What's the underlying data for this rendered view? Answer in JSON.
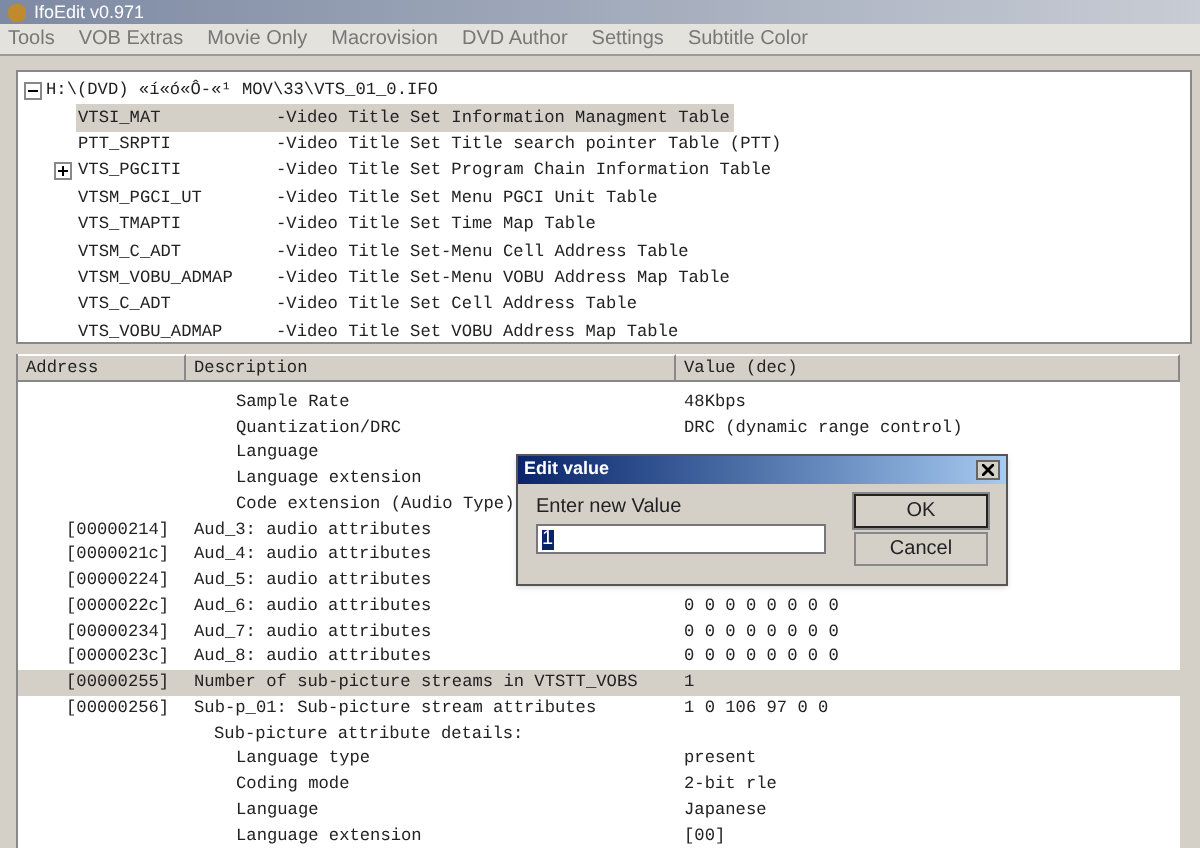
{
  "window": {
    "title": "IfoEdit v0.971"
  },
  "menu": [
    {
      "label": "Tools"
    },
    {
      "label": "VOB Extras"
    },
    {
      "label": "Movie Only"
    },
    {
      "label": "Macrovision"
    },
    {
      "label": "DVD Author"
    },
    {
      "label": "Settings"
    },
    {
      "label": "Subtitle Color"
    }
  ],
  "tree": {
    "label": "H:\\(DVD) «í«ó«Ô-«¹ MOV\\33\\VTS_01_0.IFO",
    "expanded": true,
    "children": [
      {
        "name": "VTSI_MAT",
        "description": "-Video Title Set Information Managment Table",
        "selected": true
      },
      {
        "name": "PTT_SRPTI",
        "description": "-Video Title Set Title search pointer Table (PTT)",
        "selected": false
      },
      {
        "name": "VTS_PGCITI",
        "description": "-Video Title Set Program Chain Information Table",
        "selected": false,
        "expanded": false
      },
      {
        "name": "VTSM_PGCI_UT",
        "description": "-Video Title Set Menu PGCI Unit Table",
        "selected": false
      },
      {
        "name": "VTS_TMAPTI",
        "description": "-Video Title Set Time Map Table",
        "selected": false
      },
      {
        "name": "VTSM_C_ADT",
        "description": "-Video Title Set-Menu Cell Address Table",
        "selected": false
      },
      {
        "name": "VTSM_VOBU_ADMAP",
        "description": "-Video Title Set-Menu VOBU Address Map Table",
        "selected": false
      },
      {
        "name": "VTS_C_ADT",
        "description": "-Video Title Set Cell Address Table",
        "selected": false
      },
      {
        "name": "VTS_VOBU_ADMAP",
        "description": "-Video Title Set VOBU Address Map Table",
        "selected": false
      }
    ]
  },
  "table": {
    "columns": [
      "Address",
      "Description",
      "Value (dec)"
    ],
    "rows": [
      {
        "kind": "detail",
        "description": "Sample Rate",
        "value": "48Kbps",
        "selected": false
      },
      {
        "kind": "detail",
        "description": "Quantization/DRC",
        "value": "DRC (dynamic range control)",
        "selected": false
      },
      {
        "kind": "detail",
        "description": "Language",
        "selected": false
      },
      {
        "kind": "detail",
        "description": "Language extension",
        "selected": false
      },
      {
        "kind": "detail",
        "description": "Code extension (Audio Type)",
        "selected": false
      },
      {
        "kind": "entry",
        "address": "[00000214]",
        "description": "Aud_3: audio attributes",
        "selected": false
      },
      {
        "kind": "entry",
        "address": "[0000021c]",
        "description": "Aud_4: audio attributes",
        "selected": false
      },
      {
        "kind": "entry",
        "address": "[00000224]",
        "description": "Aud_5: audio attributes",
        "selected": false
      },
      {
        "kind": "entry",
        "address": "[0000022c]",
        "description": "Aud_6: audio attributes",
        "value": "0 0 0 0 0 0 0 0",
        "selected": false
      },
      {
        "kind": "entry",
        "address": "[00000234]",
        "description": "Aud_7: audio attributes",
        "value": "0 0 0 0 0 0 0 0",
        "selected": false
      },
      {
        "kind": "entry",
        "address": "[0000023c]",
        "description": "Aud_8: audio attributes",
        "value": "0 0 0 0 0 0 0 0",
        "selected": false
      },
      {
        "kind": "entry",
        "address": "[00000255]",
        "description": "Number of sub-picture streams in VTSTT_VOBS",
        "value": "1",
        "selected": true
      },
      {
        "kind": "entry",
        "address": "[00000256]",
        "description": "Sub-p_01: Sub-picture stream attributes",
        "value": "1 0 106 97 0 0",
        "selected": false
      },
      {
        "kind": "group",
        "description": "Sub-picture attribute details:",
        "selected": false
      },
      {
        "kind": "detail",
        "description": "Language type",
        "value": "present",
        "selected": false
      },
      {
        "kind": "detail",
        "description": "Coding mode",
        "value": "2-bit rle",
        "selected": false
      },
      {
        "kind": "detail",
        "description": "Language",
        "value": "Japanese",
        "selected": false
      },
      {
        "kind": "detail",
        "description": "Language extension",
        "value": "[00]",
        "selected": false
      }
    ]
  },
  "dialog": {
    "title": "Edit value",
    "label": "Enter new Value",
    "value": "1",
    "buttons": [
      {
        "label": "OK",
        "default": true
      },
      {
        "label": "Cancel",
        "default": false
      }
    ]
  }
}
